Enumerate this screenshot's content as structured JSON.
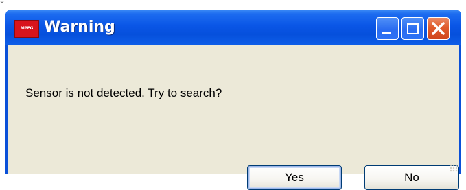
{
  "window": {
    "title": "Warning",
    "app_icon_text": "MPEG",
    "app_icon_name": "app-icon"
  },
  "titlebar_buttons": {
    "minimize_icon": "minimize-icon",
    "maximize_icon": "maximize-icon",
    "close_icon": "close-icon"
  },
  "dialog": {
    "message": "Sensor is not detected. Try to search?",
    "yes_label": "Yes",
    "no_label": "No"
  },
  "colors": {
    "titlebar": "#0a56e6",
    "client_background": "#ece9d8",
    "close_button": "#e05b2c",
    "button_border": "#003c74"
  }
}
